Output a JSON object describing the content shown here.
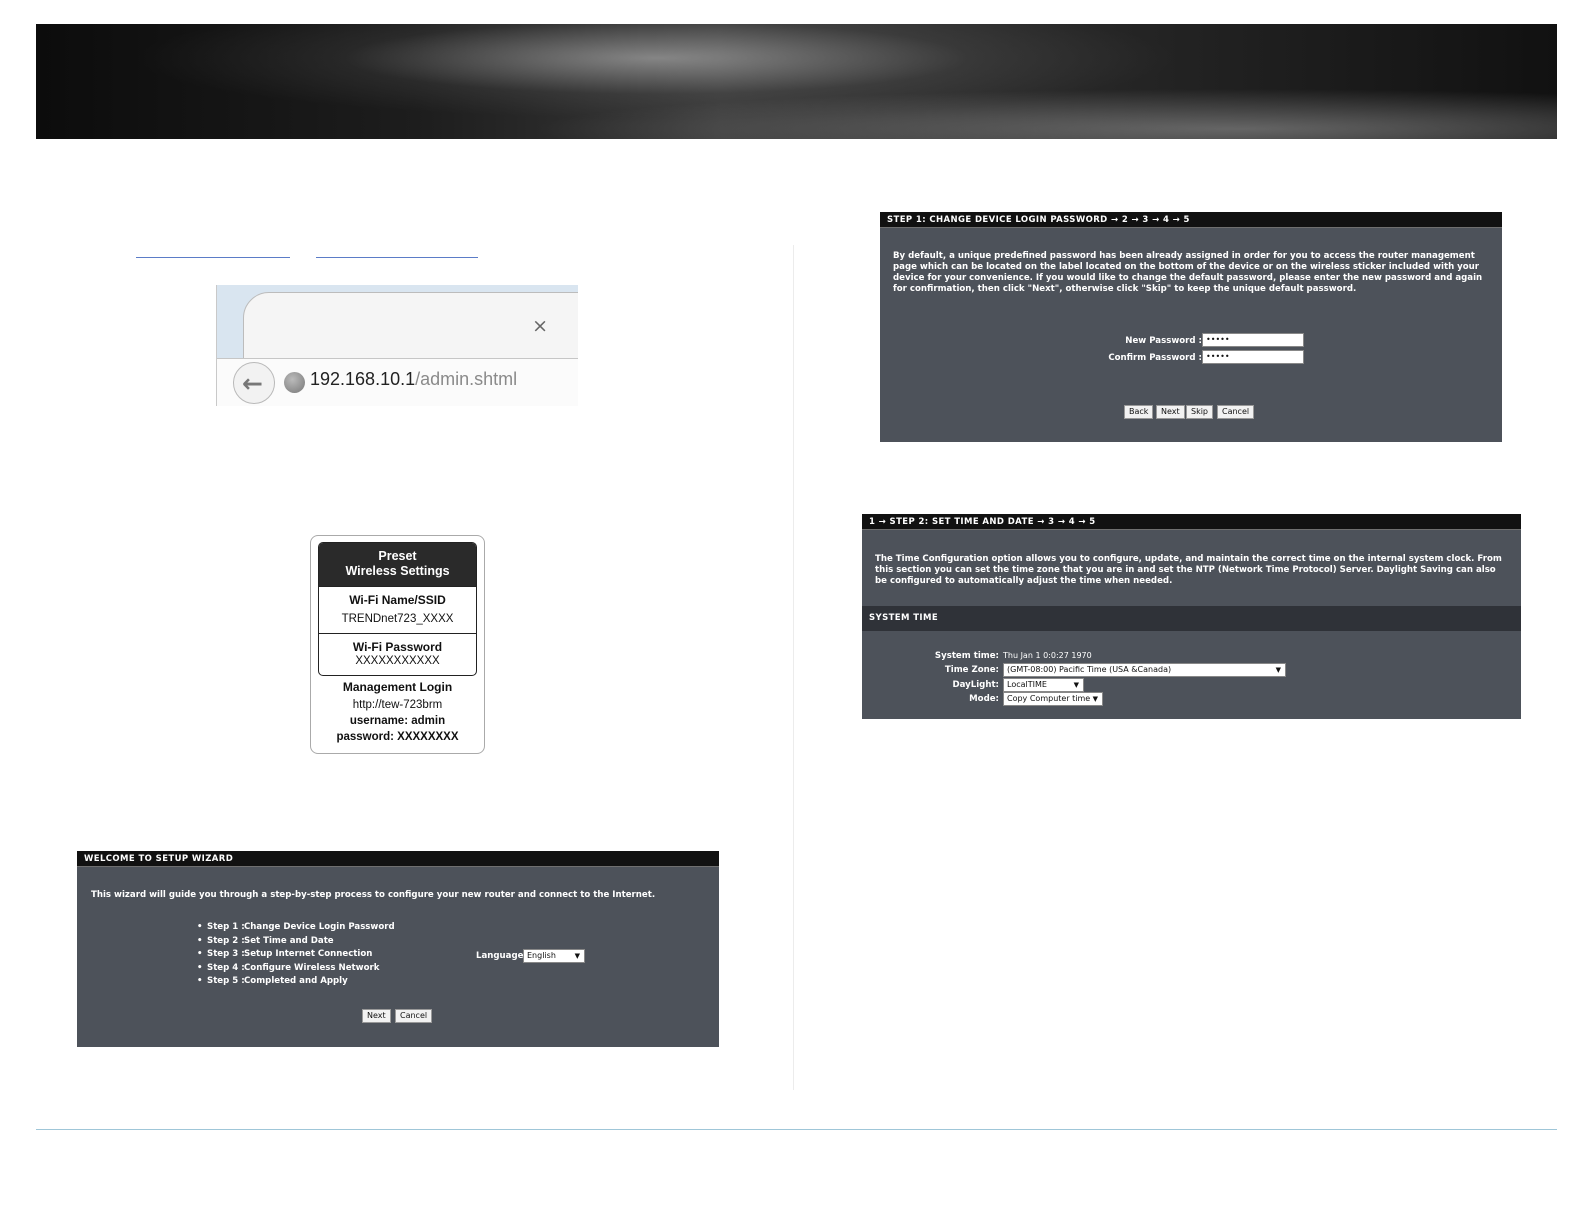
{
  "browser": {
    "tab_close": "×",
    "url_host": "192.168.10.1",
    "url_path": "/admin.shtml"
  },
  "sticker": {
    "header_line1": "Preset",
    "header_line2": "Wireless Settings",
    "ssid_label": "Wi-Fi Name/SSID",
    "ssid_value": "TRENDnet723_XXXX",
    "password_label": "Wi-Fi Password",
    "password_value": "XXXXXXXXXXX",
    "mgmt_label": "Management Login",
    "mgmt_url": "http://tew-723brm",
    "mgmt_username": "username: admin",
    "mgmt_password": "password: XXXXXXXX"
  },
  "welcome_wizard": {
    "title": "WELCOME TO SETUP WIZARD",
    "intro": "This wizard will guide you through a step-by-step process to configure your new router and connect to the Internet.",
    "steps": [
      {
        "num": "Step 1 :",
        "label": "Change Device Login Password"
      },
      {
        "num": "Step 2 :",
        "label": "Set Time and Date"
      },
      {
        "num": "Step 3 :",
        "label": "Setup Internet Connection"
      },
      {
        "num": "Step 4 :",
        "label": "Configure Wireless Network"
      },
      {
        "num": "Step 5 :",
        "label": "Completed and Apply"
      }
    ],
    "language_label": "Language:",
    "language_value": "English",
    "next": "Next",
    "cancel": "Cancel"
  },
  "step1": {
    "title": "STEP 1: CHANGE DEVICE LOGIN PASSWORD → 2 → 3 → 4 → 5",
    "description": "By default, a unique predefined password has been already assigned in order for you to access the router management page which can be located on the label located on the bottom of the device or on the wireless sticker included with your device for your convenience. If you would like to change the default password, please enter the new password and again for confirmation, then click \"Next\", otherwise click \"Skip\" to keep the unique default password.",
    "new_password_label": "New Password :",
    "new_password_value": "•••••",
    "confirm_password_label": "Confirm Password :",
    "confirm_password_value": "•••••",
    "back": "Back",
    "next": "Next",
    "skip": "Skip",
    "cancel": "Cancel"
  },
  "step2": {
    "title": "1 → STEP 2: SET TIME AND DATE → 3 → 4 → 5",
    "description": "The Time Configuration option allows you to configure, update, and maintain the correct time on the internal system clock. From this section you can set the time zone that you are in and set the NTP (Network Time Protocol) Server. Daylight Saving can also be configured to automatically adjust the time when needed.",
    "section_title": "SYSTEM TIME",
    "system_time_label": "System time:",
    "system_time_value": "Thu Jan 1 0:0:27 1970",
    "time_zone_label": "Time Zone:",
    "time_zone_value": "(GMT-08:00) Pacific Time (USA &Canada)",
    "daylight_label": "DayLight:",
    "daylight_value": "LocalTIME",
    "mode_label": "Mode:",
    "mode_value": "Copy Computer time"
  },
  "icons": {
    "dropdown": "▼",
    "back_arrow": "🡐"
  }
}
